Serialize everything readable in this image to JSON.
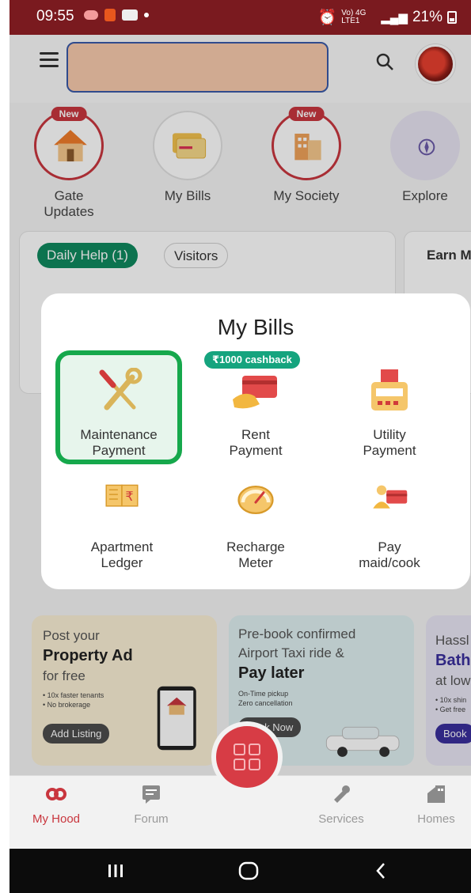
{
  "status_bar": {
    "time": "09:55",
    "network_small": "Vo) 4G LTE1",
    "battery": "21%"
  },
  "quick_actions": [
    {
      "label": "Gate Updates",
      "badge": "New"
    },
    {
      "label": "My Bills",
      "badge": ""
    },
    {
      "label": "My Society",
      "badge": "New"
    },
    {
      "label": "Explore",
      "badge": ""
    }
  ],
  "activity_card": {
    "chips": [
      "Daily Help (1)",
      "Visitors"
    ],
    "side_title": "Earn M"
  },
  "modal": {
    "title": "My Bills",
    "cashback_badge": "₹1000 cashback",
    "items": [
      {
        "line1": "Maintenance",
        "line2": "Payment",
        "icon": "wrench-screwdriver-icon",
        "selected": true
      },
      {
        "line1": "Rent",
        "line2": "Payment",
        "icon": "rent-card-icon"
      },
      {
        "line1": "Utility",
        "line2": "Payment",
        "icon": "utility-bill-icon"
      },
      {
        "line1": "Apartment",
        "line2": "Ledger",
        "icon": "ledger-book-icon"
      },
      {
        "line1": "Recharge",
        "line2": "Meter",
        "icon": "meter-gauge-icon"
      },
      {
        "line1": "Pay",
        "line2": "maid/cook",
        "icon": "pay-maid-icon"
      }
    ]
  },
  "banners": [
    {
      "line1": "Post your",
      "line2": "Property Ad",
      "line3": "for free",
      "bullets": [
        "• 10x faster tenants",
        "• No brokerage"
      ],
      "button": "Add Listing"
    },
    {
      "line1": "Pre-book confirmed",
      "line2": "Airport Taxi ride &",
      "line3": "Pay later",
      "bullets": [
        "On-Time pickup",
        "Zero cancellation"
      ],
      "button": "Book Now"
    },
    {
      "line1": "Hassl",
      "line2": "Bath",
      "line3": "at low",
      "bullets": [
        "• 10x shin",
        "• Get free"
      ],
      "button": "Book"
    }
  ],
  "bottom_nav": [
    {
      "label": "My Hood",
      "active": true
    },
    {
      "label": "Forum",
      "active": false
    },
    {
      "label": "Services",
      "active": false
    },
    {
      "label": "Homes",
      "active": false
    }
  ],
  "colors": {
    "brand_red": "#c9363e",
    "highlight_green": "#16a84c",
    "cashback_green": "#15a47e",
    "status_bar": "#7a1a1f"
  }
}
